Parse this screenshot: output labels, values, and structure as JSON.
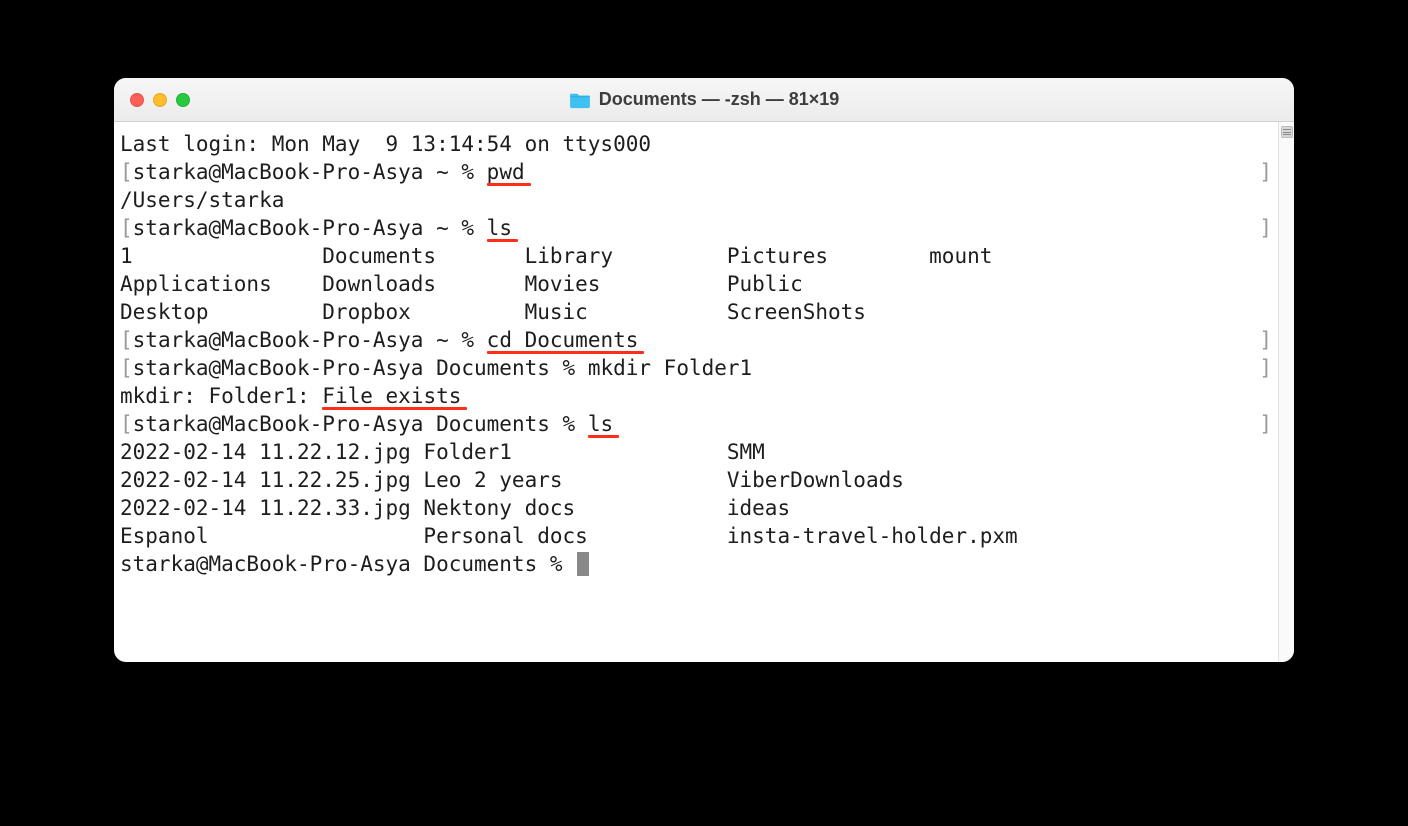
{
  "titlebar": {
    "title_text": "Documents — -zsh — 81×19"
  },
  "lines": {
    "last_login": "Last login: Mon May  9 13:14:54 on ttys000",
    "prompt_home_open": "[",
    "prompt_home_close": "]",
    "prompt_home": "starka@MacBook-Pro-Asya ~ % ",
    "prompt_docs": "starka@MacBook-Pro-Asya Documents % ",
    "cmd_pwd": "pwd",
    "pwd_out": "/Users/starka",
    "cmd_ls1": "ls",
    "ls1_row1": "1               Documents       Library         Pictures        mount",
    "ls1_row2": "Applications    Downloads       Movies          Public",
    "ls1_row3": "Desktop         Dropbox         Music           ScreenShots",
    "cmd_cd": "cd Documents",
    "cmd_mkdir": "mkdir Folder1",
    "mkdir_err_pre": "mkdir: Folder1: ",
    "mkdir_err_msg": "File exists",
    "cmd_ls2": "ls",
    "ls2_row1": "2022-02-14 11.22.12.jpg Folder1                 SMM",
    "ls2_row2": "2022-02-14 11.22.25.jpg Leo 2 years             ViberDownloads",
    "ls2_row3": "2022-02-14 11.22.33.jpg Nektony docs            ideas",
    "ls2_row4": "Espanol                 Personal docs           insta-travel-holder.pxm"
  }
}
